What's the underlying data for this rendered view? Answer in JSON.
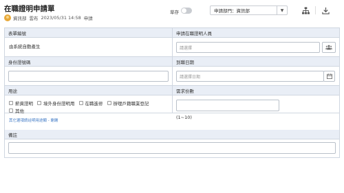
{
  "header": {
    "title": "在職證明申請單",
    "author_dept": "資訊部",
    "author_name": "雲布",
    "timestamp": "2023/05/31 14:58",
    "status": "申請",
    "draft_label": "草存",
    "dept_select_value": "申請部門：資訊部",
    "icons": [
      "org-chart-icon",
      "download-icon"
    ]
  },
  "form": {
    "form_no": {
      "label": "表單編號",
      "value": "由系統自動產生"
    },
    "applicant": {
      "label": "申請在職證明人員",
      "placeholder": "請選擇"
    },
    "id_no": {
      "label": "身份證號碼",
      "value": ""
    },
    "start_date": {
      "label": "到職日期",
      "placeholder": "請選擇日期"
    },
    "purpose": {
      "label": "用途",
      "options": [
        "薪資證明",
        "境外身份證明用",
        "在職進修",
        "辦理戶籍職業登記",
        "其他"
      ],
      "note": "其它選項請註明用途類 - 謝謝"
    },
    "copies": {
      "label": "需求份數",
      "range_hint": "(1~10)"
    },
    "remarks": {
      "label": "備註"
    }
  }
}
